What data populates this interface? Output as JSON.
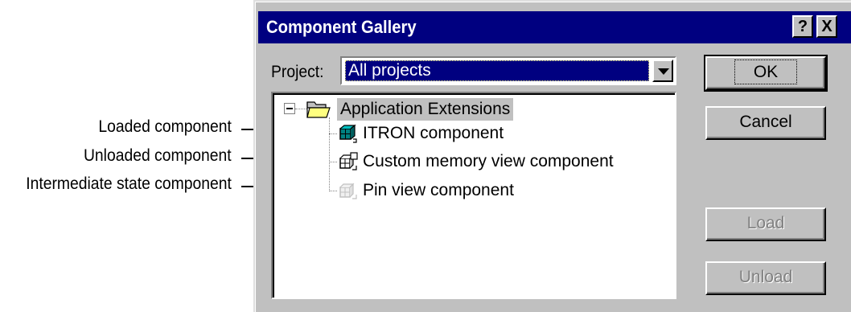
{
  "callouts": {
    "loaded": "Loaded component",
    "unloaded": "Unloaded component",
    "intermediate": "Intermediate state component"
  },
  "dialog": {
    "title": "Component Gallery",
    "help_button": "?",
    "close_button": "X",
    "project_label": "Project:",
    "project_value": "All projects",
    "tree": {
      "root": "Application Extensions",
      "items": [
        {
          "label": "ITRON component",
          "state": "loaded"
        },
        {
          "label": "Custom memory view component",
          "state": "unloaded"
        },
        {
          "label": "Pin view component",
          "state": "intermediate"
        }
      ]
    },
    "buttons": {
      "ok": "OK",
      "cancel": "Cancel",
      "load": "Load",
      "unload": "Unload"
    }
  },
  "colors": {
    "titlebar": "#000080",
    "dialog_face": "#c0c0c0",
    "disabled_text": "#808080"
  }
}
